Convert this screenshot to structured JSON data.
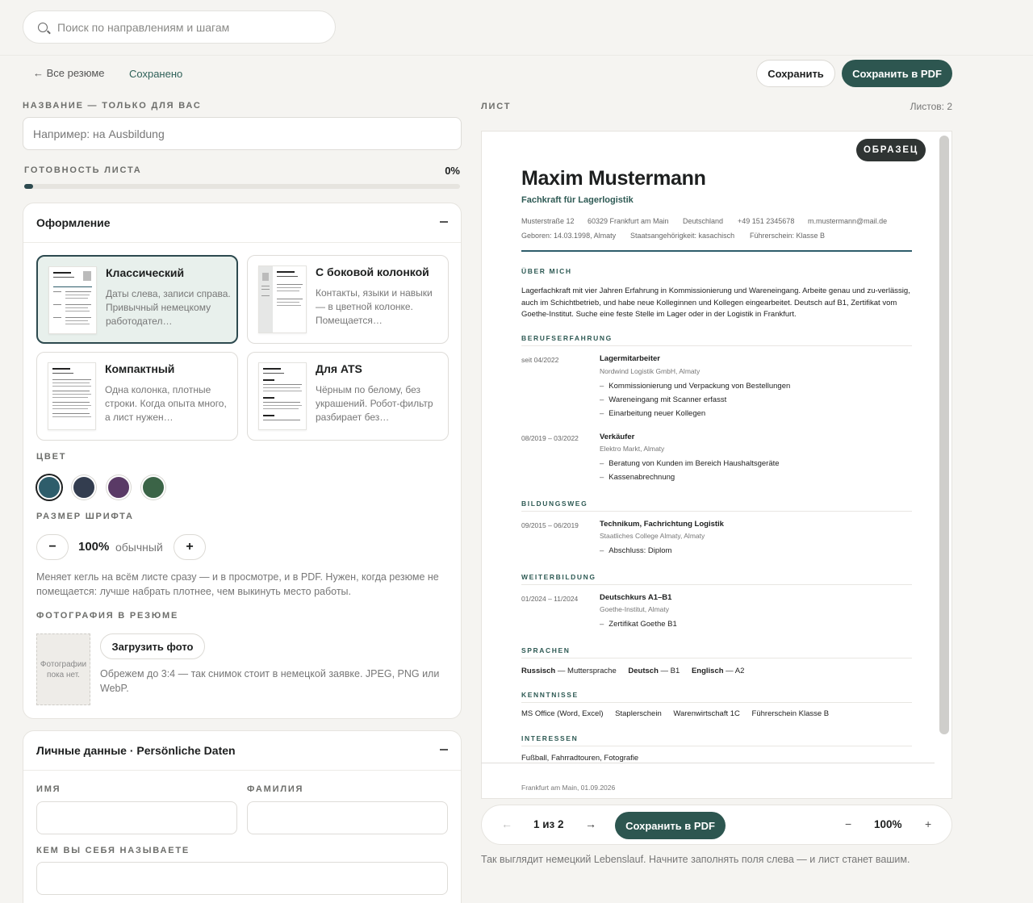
{
  "search": {
    "placeholder": "Поиск по направлениям и шагам"
  },
  "topbar": {
    "back": "← Все резюме",
    "status": "Сохранено",
    "save": "Сохранить",
    "save_pdf": "Сохранить в PDF"
  },
  "left": {
    "name_label": "НАЗВАНИЕ — ТОЛЬКО ДЛЯ ВАС",
    "name_placeholder": "Например: на Ausbildung",
    "readiness_label": "ГОТОВНОСТЬ ЛИСТА",
    "readiness_value": "0%",
    "readiness_fraction": 0.0,
    "design": {
      "title": "Оформление",
      "templates": [
        {
          "title": "Классический",
          "desc": "Даты слева, записи справа. Привычный немецкому работодател…",
          "selected": true
        },
        {
          "title": "С боковой колонкой",
          "desc": "Контакты, языки и навыки — в цветной колонке. Помещается…"
        },
        {
          "title": "Компактный",
          "desc": "Одна колонка, плотные строки. Когда опыта много, а лист нужен…"
        },
        {
          "title": "Для ATS",
          "desc": "Чёрным по белому, без украшений. Робот-фильтр разбирает без…"
        }
      ],
      "color_label": "ЦВЕТ",
      "colors": [
        "#2e5d6b",
        "#333d4f",
        "#5a3a66",
        "#3b6447"
      ],
      "font_label": "РАЗМЕР ШРИФТА",
      "font_value": "100%",
      "font_unit": "обычный",
      "font_minus": "−",
      "font_plus": "+",
      "font_hint": "Меняет кегль на всём листе сразу — и в просмотре, и в PDF. Нужен, когда резюме не помещается: лучше набрать плотнее, чем выкинуть место работы.",
      "photo_label": "ФОТОГРАФИЯ В РЕЗЮМЕ",
      "photo_empty": "Фотографии пока нет.",
      "upload": "Загрузить фото",
      "photo_hint": "Обрежем до 3:4 — так снимок стоит в немецкой заявке. JPEG, PNG или WebP."
    },
    "personal": {
      "title": "Личные данные · Persönliche Daten",
      "first_label": "ИМЯ",
      "last_label": "ФАМИЛИЯ",
      "role_label": "КЕМ ВЫ СЕБЯ НАЗЫВАЕТЕ"
    }
  },
  "sheet": {
    "label": "ЛИСТ",
    "count": "Листов: 2",
    "badge": "ОБРАЗЕЦ",
    "name": "Maxim Mustermann",
    "subtitle": "Fachkraft für Lagerlogistik",
    "meta1": [
      "Musterstraße 12",
      "60329 Frankfurt am Main",
      "Deutschland",
      "+49 151 2345678",
      "m.mustermann@mail.de"
    ],
    "meta2": [
      "Geboren: 14.03.1998, Almaty",
      "Staatsangehörigkeit: kasachisch",
      "Führerschein: Klasse B"
    ],
    "about_head": "ÜBER MICH",
    "about": "Lagerfachkraft mit vier Jahren Erfahrung in Kommissionierung und Wareneingang. Arbeite genau und zu-verlässig, auch im Schichtbetrieb, und habe neue Kolleginnen und Kollegen eingearbeitet. Deutsch auf B1, Zertifikat vom Goethe-Institut. Suche eine feste Stelle im Lager oder in der Logistik in Frankfurt.",
    "exp_head": "BERUFSERFAHRUNG",
    "job1": {
      "date": "seit 04/2022",
      "title": "Lagermitarbeiter",
      "company": "Nordwind Logistik GmbH, Almaty",
      "bullets": [
        "Kommissionierung und Verpackung von Bestellungen",
        "Wareneingang mit Scanner erfasst",
        "Einarbeitung neuer Kollegen"
      ]
    },
    "job2": {
      "date": "08/2019 – 03/2022",
      "title": "Verkäufer",
      "company": "Elektro Markt, Almaty",
      "bullets": [
        "Beratung von Kunden im Bereich Haushaltsgeräte",
        "Kassenabrechnung"
      ]
    },
    "edu_head": "BILDUNGSWEG",
    "edu": {
      "date": "09/2015 – 06/2019",
      "title": "Technikum, Fachrichtung Logistik",
      "company": "Staatliches College Almaty, Almaty",
      "bullets": [
        "Abschluss: Diplom"
      ]
    },
    "wb_head": "WEITERBILDUNG",
    "wb": {
      "date": "01/2024 – 11/2024",
      "title": "Deutschkurs A1–B1",
      "company": "Goethe-Institut, Almaty",
      "bullets": [
        "Zertifikat Goethe B1"
      ]
    },
    "lang_head": "SPRACHEN",
    "langs": [
      {
        "name": "Russisch",
        "level": "— Muttersprache"
      },
      {
        "name": "Deutsch",
        "level": "— B1"
      },
      {
        "name": "Englisch",
        "level": "— A2"
      }
    ],
    "skills_head": "KENNTNISSE",
    "skills": [
      "MS Office (Word, Excel)",
      "Staplerschein",
      "Warenwirtschaft 1C",
      "Führerschein Klasse B"
    ],
    "int_head": "INTERESSEN",
    "interests": "Fußball, Fahrradtouren, Fotografie",
    "footer": "Frankfurt am Main, 01.09.2026"
  },
  "toolbar": {
    "prev": "←",
    "page": "1 из 2",
    "next": "→",
    "pdf": "Сохранить в PDF",
    "zoom_out": "−",
    "zoom": "100%",
    "zoom_in": "+"
  },
  "note": "Так выглядит немецкий Lebenslauf. Начните заполнять поля слева — и лист станет вашим."
}
